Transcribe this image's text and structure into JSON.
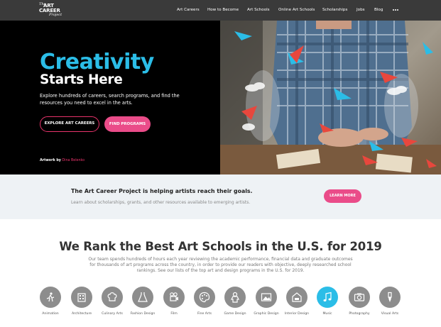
{
  "logo": {
    "line1": "The",
    "line2": "ART",
    "line3": "CAREER",
    "line4": "Project"
  },
  "nav": {
    "items": [
      "Art Careers",
      "How to Become",
      "Art Schools",
      "Online Art Schools",
      "Scholarships",
      "Jobs",
      "Blog"
    ],
    "more_icon": "more-dots-icon"
  },
  "hero": {
    "title": "Creativity",
    "subtitle": "Starts Here",
    "description": "Explore hundreds of careers, search programs, and find the resources you need to excel in the arts.",
    "btn_explore": "EXPLORE ART CAREERS",
    "btn_find": "FIND PROGRAMS",
    "credit_prefix": "Artwork by",
    "credit_name": "Dina Belenko"
  },
  "banner": {
    "title": "The Art Career Project is helping artists reach their goals.",
    "subtitle": "Learn about scholarships, grants, and other resources available to emerging artists.",
    "button": "LEARN MORE"
  },
  "rank": {
    "title": "We Rank the Best Art Schools in the U.S. for 2019",
    "description": "Our team spends hundreds of hours each year reviewing the academic performance, financial data and graduate outcomes for thousands of art programs across the country, in order to provide our readers with objective, deeply researched school rankings. See our lists of the top art and design programs in the U.S. for 2019."
  },
  "categories": [
    {
      "label": "Animation",
      "icon": "animation-icon"
    },
    {
      "label": "Architecture",
      "icon": "architecture-icon"
    },
    {
      "label": "Culinary Arts",
      "icon": "chef-hat-icon"
    },
    {
      "label": "Fashion Design",
      "icon": "dress-icon"
    },
    {
      "label": "Film",
      "icon": "film-camera-icon"
    },
    {
      "label": "Fine Arts",
      "icon": "palette-icon"
    },
    {
      "label": "Game Design",
      "icon": "game-character-icon"
    },
    {
      "label": "Graphic Design",
      "icon": "image-frame-icon"
    },
    {
      "label": "Interior Design",
      "icon": "room-icon"
    },
    {
      "label": "Music",
      "icon": "music-note-icon"
    },
    {
      "label": "Photography",
      "icon": "camera-icon"
    },
    {
      "label": "Visual Arts",
      "icon": "brush-icon"
    }
  ],
  "colors": {
    "accent_blue": "#2bbde7",
    "accent_pink": "#ea4c89",
    "nav_bg": "#3a3a3a",
    "icon_grey": "#8d8d8d"
  }
}
